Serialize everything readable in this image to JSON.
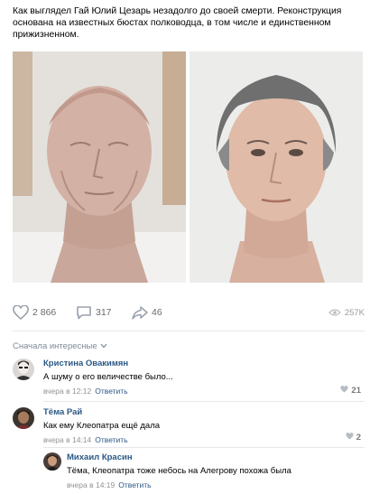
{
  "post": {
    "text": "Как выглядел Гай Юлий Цезарь незадолго до своей смерти. Реконструкция основана на известных бюстах полководца, в том числе и единственном прижизненном."
  },
  "actions": {
    "likes": "2 866",
    "comments": "317",
    "shares": "46",
    "views": "257K"
  },
  "comments_sort": "Сначала интересные",
  "comments": [
    {
      "author": "Кристина Овакимян",
      "text": "А шуму о его величестве было...",
      "time": "вчера в 12:12",
      "reply_label": "Ответить",
      "likes": "21"
    },
    {
      "author": "Тёма Рай",
      "text": "Как ему Клеопатра ещё дала",
      "time": "вчера в 14:14",
      "reply_label": "Ответить",
      "likes": "2"
    },
    {
      "author": "Михаил Красин",
      "text": "Тёма, Клеопатра тоже небось на Алегрову похожа была",
      "time": "вчера в 14:19",
      "reply_label": "Ответить"
    }
  ],
  "icons": {
    "like": "heart-icon",
    "comment": "speech-bubble-icon",
    "share": "share-arrow-icon",
    "views": "eye-icon",
    "sort": "chevron-down-icon"
  },
  "colors": {
    "link": "#2a5885",
    "meta": "#939393",
    "icon": "#99a2ad"
  }
}
